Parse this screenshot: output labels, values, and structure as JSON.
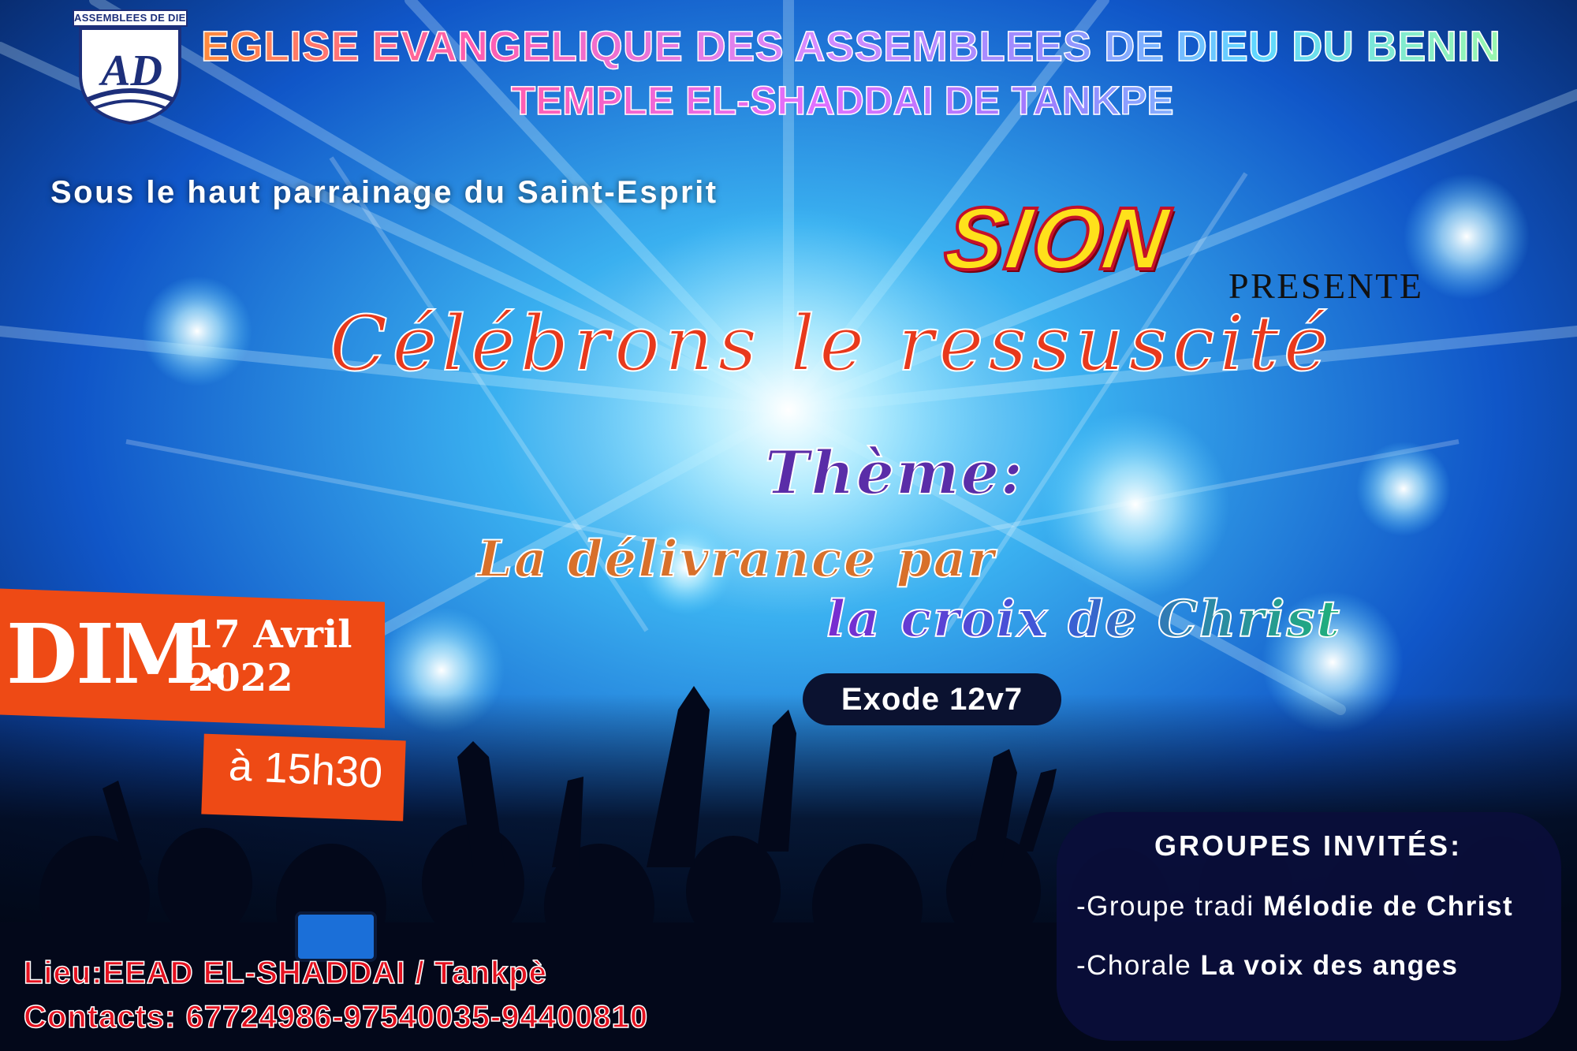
{
  "header": {
    "logo_banner": "ASSEMBLEES DE DIEU",
    "logo_letters": "AD",
    "church_name": "EGLISE EVANGELIQUE DES ASSEMBLEES DE DIEU DU BENIN",
    "temple_name": "TEMPLE EL-SHADDAI DE TANKPE"
  },
  "sponsor": "Sous le haut parrainage du Saint-Esprit",
  "presenter": {
    "name": "SION",
    "verb": "PRESENTE"
  },
  "event_title": "Célébrons le ressuscité",
  "theme": {
    "label": "Thème:",
    "line1": "La délivrance par",
    "line2": "la croix de Christ",
    "verse": "Exode 12v7"
  },
  "schedule": {
    "day": "DIM.",
    "date_line1": "17 Avril",
    "date_line2": "2022",
    "time": "à 15h30"
  },
  "guests": {
    "title": "GROUPES INVITÉS:",
    "items": [
      {
        "prefix": "-Groupe tradi ",
        "name": "Mélodie de Christ"
      },
      {
        "prefix": "-Chorale ",
        "name": "La voix des anges"
      }
    ]
  },
  "footer": {
    "location": "Lieu:EEAD EL-SHADDAI / Tankpè",
    "contacts": "Contacts: 67724986-97540035-94400810"
  },
  "colors": {
    "accent_orange": "#ee4a15",
    "sion_yellow": "#ffe11b",
    "footer_red": "#e4111f",
    "guest_panel": "#0a0e3a"
  }
}
